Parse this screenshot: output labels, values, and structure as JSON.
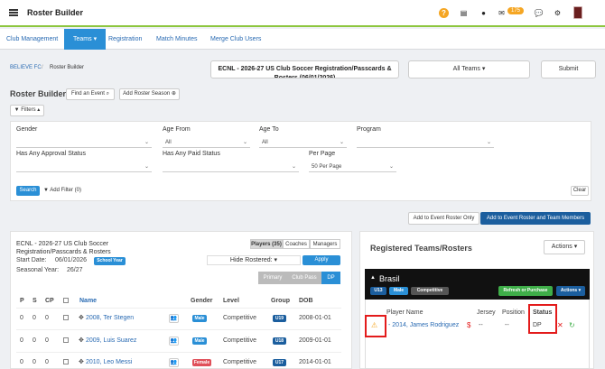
{
  "app": {
    "title": "Roster Builder",
    "mail_count": "175"
  },
  "top_icons": [
    "help-icon",
    "doc-icon",
    "user-icon",
    "mail-icon",
    "chat-icon",
    "gear-icon",
    "club-crest-icon"
  ],
  "nav": {
    "items": [
      "Club Management",
      "Teams",
      "Registration",
      "Match Minutes",
      "Merge Club Users"
    ],
    "active": "Teams"
  },
  "breadcrumb": {
    "club": "BELIEVE FC",
    "page": "Roster Builder"
  },
  "season_select": "ECNL - 2026-27 US Club Soccer Registration/Passcards & Rosters (06/01/2026)",
  "teams_select": "All Teams",
  "submit_label": "Submit",
  "roster": {
    "title": "Roster Builder",
    "find_event_label": "Find an Event",
    "add_season_label": "Add Roster Season",
    "filters_label": "Filters"
  },
  "filters": {
    "gender": {
      "label": "Gender",
      "value": ""
    },
    "age_from": {
      "label": "Age From",
      "value": "All"
    },
    "age_to": {
      "label": "Age To",
      "value": "All"
    },
    "program": {
      "label": "Program",
      "value": ""
    },
    "approval": {
      "label": "Has Any Approval Status",
      "value": ""
    },
    "paid": {
      "label": "Has Any Paid Status",
      "value": ""
    },
    "per_page": {
      "label": "Per Page",
      "value": "50 Per Page"
    },
    "search_label": "Search",
    "add_filter_label": "Add Filter (0)",
    "clear_label": "Clear"
  },
  "event_buttons": {
    "roster_only": "Add to Event Roster Only",
    "roster_members": "Add to Event Roster and Team Members"
  },
  "left_card": {
    "title_line1": "ECNL - 2026-27 US Club Soccer",
    "title_line2": "Registration/Passcards & Rosters",
    "tabs": [
      "Players (35)",
      "Coaches",
      "Managers"
    ],
    "start_label": "Start Date:",
    "start_value": "06/01/2026",
    "school_badge": "School Year",
    "seasonal_label": "Seasonal Year:",
    "seasonal_value": "26/27",
    "hide_rostered_label": "Hide Rostered:",
    "apply_label": "Apply",
    "pass_tabs": [
      "Primary",
      "Club Pass",
      "DP"
    ],
    "columns": [
      "P",
      "S",
      "CP",
      "",
      "Name",
      "",
      "Gender",
      "Level",
      "Group",
      "DOB"
    ],
    "players": [
      {
        "p": "0",
        "s": "0",
        "cp": "0",
        "name": "2008, Ter Stegen",
        "gender": "Male",
        "level": "Competitive",
        "group": "U19",
        "dob": "2008-01-01"
      },
      {
        "p": "0",
        "s": "0",
        "cp": "0",
        "name": "2009, Luis Suarez",
        "gender": "Male",
        "level": "Competitive",
        "group": "U18",
        "dob": "2009-01-01"
      },
      {
        "p": "0",
        "s": "0",
        "cp": "0",
        "name": "2010, Leo Messi",
        "gender": "Female",
        "level": "Competitive",
        "group": "U17",
        "dob": "2014-01-01"
      }
    ]
  },
  "right_card": {
    "title": "Registered Teams/Rosters",
    "actions_label": "Actions",
    "team": {
      "name": "Brasil",
      "badges": [
        "U13",
        "Male",
        "Competitive"
      ],
      "refresh_label": "Refresh or Purchase",
      "actions_label": "Actions",
      "columns": [
        "Player Name",
        "Jersey",
        "Position",
        "Status"
      ],
      "rows": [
        {
          "name": "2014, James Rodriguez",
          "jersey": "--",
          "position": "--",
          "status": "DP"
        }
      ]
    }
  },
  "colors": {
    "primary": "#2a8fd6",
    "accent_green": "#8dc63f",
    "highlight_red": "#e31b1b",
    "header_dark": "#111111"
  }
}
